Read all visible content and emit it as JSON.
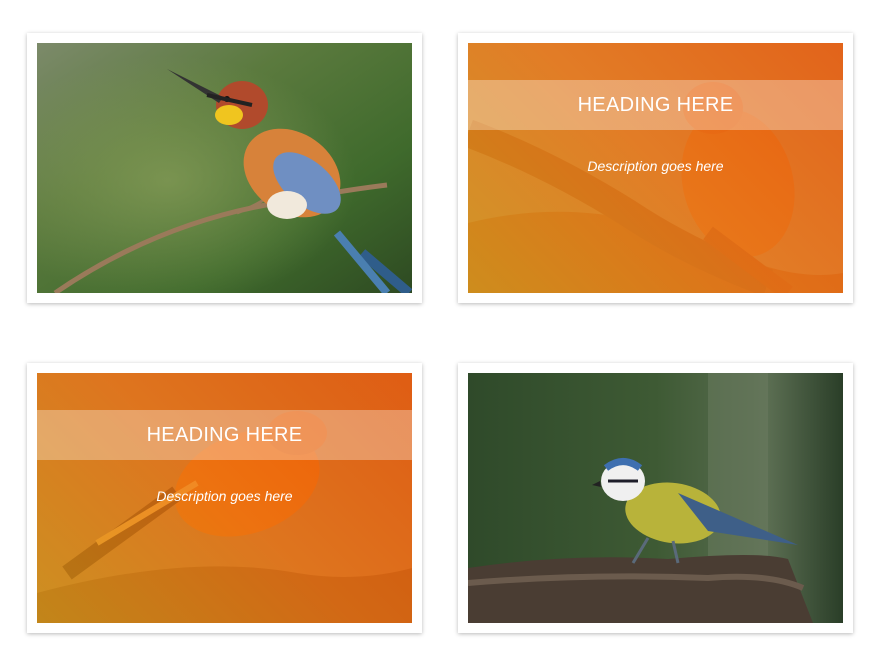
{
  "gallery": {
    "items": [
      {
        "id": "bee-eater",
        "icon": "bee-eater-photo",
        "hover": false
      },
      {
        "id": "bee-eater-hover",
        "icon": "bee-eater-photo",
        "hover": true,
        "heading": "HEADING HERE",
        "description": "Description goes here"
      },
      {
        "id": "oriole-hover",
        "icon": "oriole-photo",
        "hover": true,
        "heading": "HEADING HERE",
        "description": "Description goes here"
      },
      {
        "id": "blue-tit",
        "icon": "blue-tit-photo",
        "hover": false
      }
    ]
  },
  "colors": {
    "overlay_start": "#d69212",
    "overlay_end": "#ee5000",
    "background": "#ffffff"
  }
}
